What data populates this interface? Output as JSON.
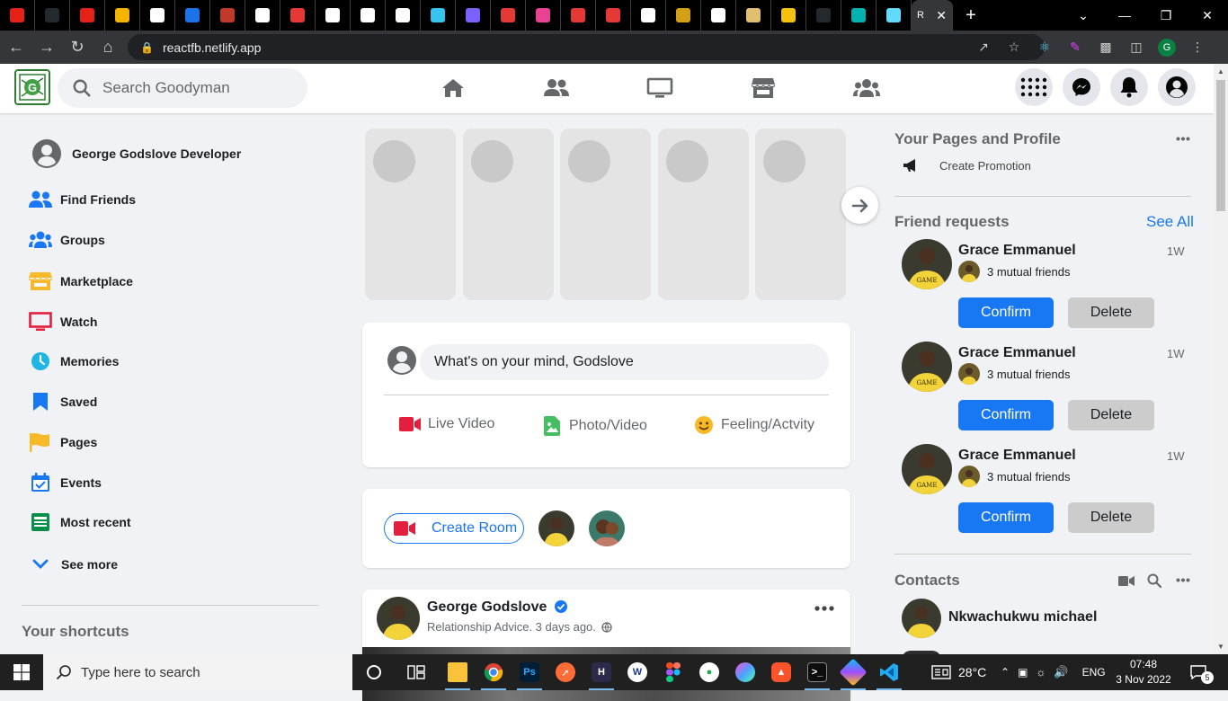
{
  "browser": {
    "active_tab_title": "R",
    "url": "reactfb.netlify.app",
    "tab_favicon_colors": [
      "#e62117",
      "#24292e",
      "#e62117",
      "#f4b400",
      "#ffffff",
      "#1a73e8",
      "#c0392b",
      "#ffffff",
      "#e53935",
      "#ffffff",
      "#ffffff",
      "#ffffff",
      "#36c5f0",
      "#7b61ff",
      "#e53935",
      "#e84393",
      "#e53935",
      "#e53935",
      "#ffffff",
      "#d4a017",
      "#ffffff",
      "#e0c070",
      "#f4c20d",
      "#24292e",
      "#00b3b3",
      "#61dafb"
    ],
    "profile_initial": "G"
  },
  "fb": {
    "search_placeholder": "Search Goodyman",
    "user_name": "George Godslove Developer",
    "menu": [
      {
        "label": "Find Friends",
        "icon": "friends-icon"
      },
      {
        "label": "Groups",
        "icon": "groups-icon"
      },
      {
        "label": "Marketplace",
        "icon": "marketplace-icon"
      },
      {
        "label": "Watch",
        "icon": "watch-icon"
      },
      {
        "label": "Memories",
        "icon": "clock-icon"
      },
      {
        "label": "Saved",
        "icon": "bookmark-icon"
      },
      {
        "label": "Pages",
        "icon": "flag-icon"
      },
      {
        "label": "Events",
        "icon": "calendar-icon"
      },
      {
        "label": "Most recent",
        "icon": "feed-icon"
      }
    ],
    "see_more": "See more",
    "your_shortcuts": "Your shortcuts",
    "composer": {
      "prompt": "What's on your mind, Godslove",
      "live": "Live Video",
      "photo": "Photo/Video",
      "feeling": "Feeling/Actvity"
    },
    "create_room": "Create Room",
    "post": {
      "author": "George Godslove",
      "meta": "Relationship Advice. 3 days ago."
    },
    "right": {
      "pages_title": "Your Pages and Profile",
      "create_promotion": "Create Promotion",
      "friend_requests": "Friend requests",
      "see_all": "See All",
      "requests": [
        {
          "name": "Grace Emmanuel",
          "time": "1W",
          "mutual": "3 mutual friends",
          "confirm": "Confirm",
          "delete": "Delete"
        },
        {
          "name": "Grace Emmanuel",
          "time": "1W",
          "mutual": "3 mutual friends",
          "confirm": "Confirm",
          "delete": "Delete"
        },
        {
          "name": "Grace Emmanuel",
          "time": "1W",
          "mutual": "3 mutual friends",
          "confirm": "Confirm",
          "delete": "Delete"
        }
      ],
      "contacts_title": "Contacts",
      "contact_name": "Nkwachukwu michael"
    }
  },
  "taskbar": {
    "search_placeholder": "Type here to search",
    "weather": "28°C",
    "lang": "ENG",
    "time": "07:48",
    "date": "3 Nov 2022",
    "notifications": "5"
  },
  "colors": {
    "fb_blue": "#1877f2",
    "red": "#e41e3f",
    "green": "#45bd62",
    "yellow": "#f7b928"
  }
}
